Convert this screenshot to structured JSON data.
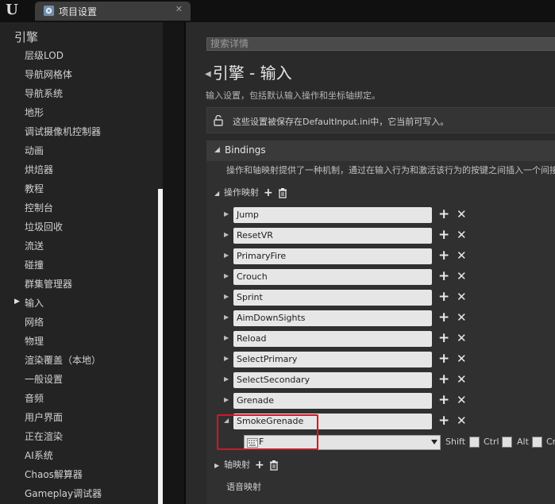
{
  "titlebar": {
    "logo": "U",
    "tab_title": "项目设置",
    "close_symbol": "✕"
  },
  "sidebar": {
    "header": "引擎",
    "selected": "输入",
    "items": [
      "层级LOD",
      "导航网格体",
      "导航系统",
      "地形",
      "调试摄像机控制器",
      "动画",
      "烘焙器",
      "教程",
      "控制台",
      "垃圾回收",
      "流送",
      "碰撞",
      "群集管理器",
      "输入",
      "网络",
      "物理",
      "渲染覆盖（本地）",
      "一般设置",
      "音频",
      "用户界面",
      "正在渲染",
      "AI系统",
      "Chaos解算器",
      "Gameplay调试器"
    ]
  },
  "main": {
    "search_placeholder": "搜索详情",
    "page_title": "引擎 - 输入",
    "page_description": "输入设置，包括默认输入操作和坐标轴绑定。",
    "notice": "这些设置被保存在DefaultInput.ini中，它当前可写入。",
    "bindings": {
      "title": "Bindings",
      "description": "操作和轴映射提供了一种机制，通过在输入行为和激活该行为的按键之间插入一个间接",
      "action_mappings_label": "操作映射",
      "axis_mappings_label": "轴映射",
      "speech_mappings_label": "语音映射",
      "actions": [
        "Jump",
        "ResetVR",
        "PrimaryFire",
        "Crouch",
        "Sprint",
        "AimDownSights",
        "Reload",
        "SelectPrimary",
        "SelectSecondary",
        "Grenade",
        "SmokeGrenade"
      ],
      "expanded_key": "F",
      "modifiers": [
        "Shift",
        "Ctrl",
        "Alt",
        "Cmd"
      ]
    }
  },
  "colors": {
    "highlight": "#e0101e",
    "sidebar_bg": "#232323",
    "main_bg": "#2a2a2a"
  }
}
